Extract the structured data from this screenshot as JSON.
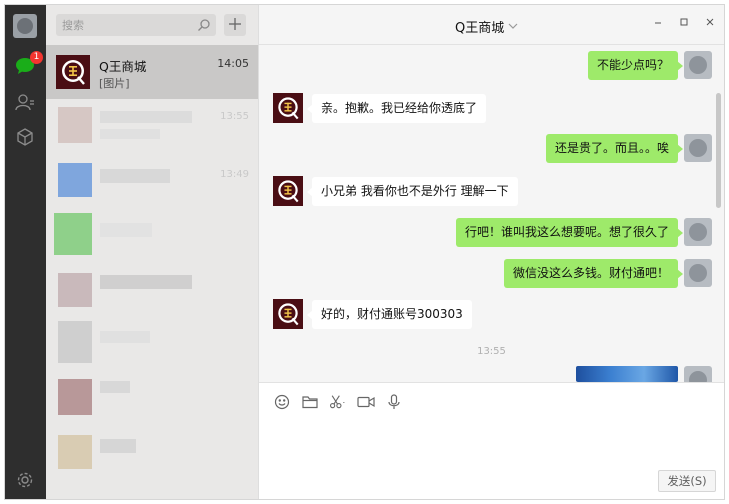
{
  "search": {
    "placeholder": "搜索"
  },
  "sidebar": {
    "unread_badge": "1"
  },
  "conversations": [
    {
      "name": "Q王商城",
      "preview": "[图片]",
      "time": "14:05"
    }
  ],
  "list_faint_times": [
    "13:55",
    "13:49"
  ],
  "chat": {
    "title": "Q王商城",
    "messages": [
      {
        "side": "right",
        "text": "不能少点吗？"
      },
      {
        "side": "left",
        "text": "亲。抱歉。我已经给你透底了"
      },
      {
        "side": "right",
        "text": "还是贵了。而且。。唉"
      },
      {
        "side": "left",
        "text": "小兄弟 我看你也不是外行 理解一下"
      },
      {
        "side": "right",
        "text": "行吧！谁叫我这么想要呢。想了很久了"
      },
      {
        "side": "right",
        "text": "微信没这么多钱。财付通吧！"
      },
      {
        "side": "left",
        "text": "好的，财付通账号300303"
      }
    ],
    "timestamp": "13:55"
  },
  "input": {
    "send_label": "发送(S)"
  },
  "colors": {
    "sidebar_bg": "#2e2e2e",
    "self_bubble": "#9eea6a",
    "badge": "#f43530",
    "brand_avatar": "#4a0e14"
  }
}
